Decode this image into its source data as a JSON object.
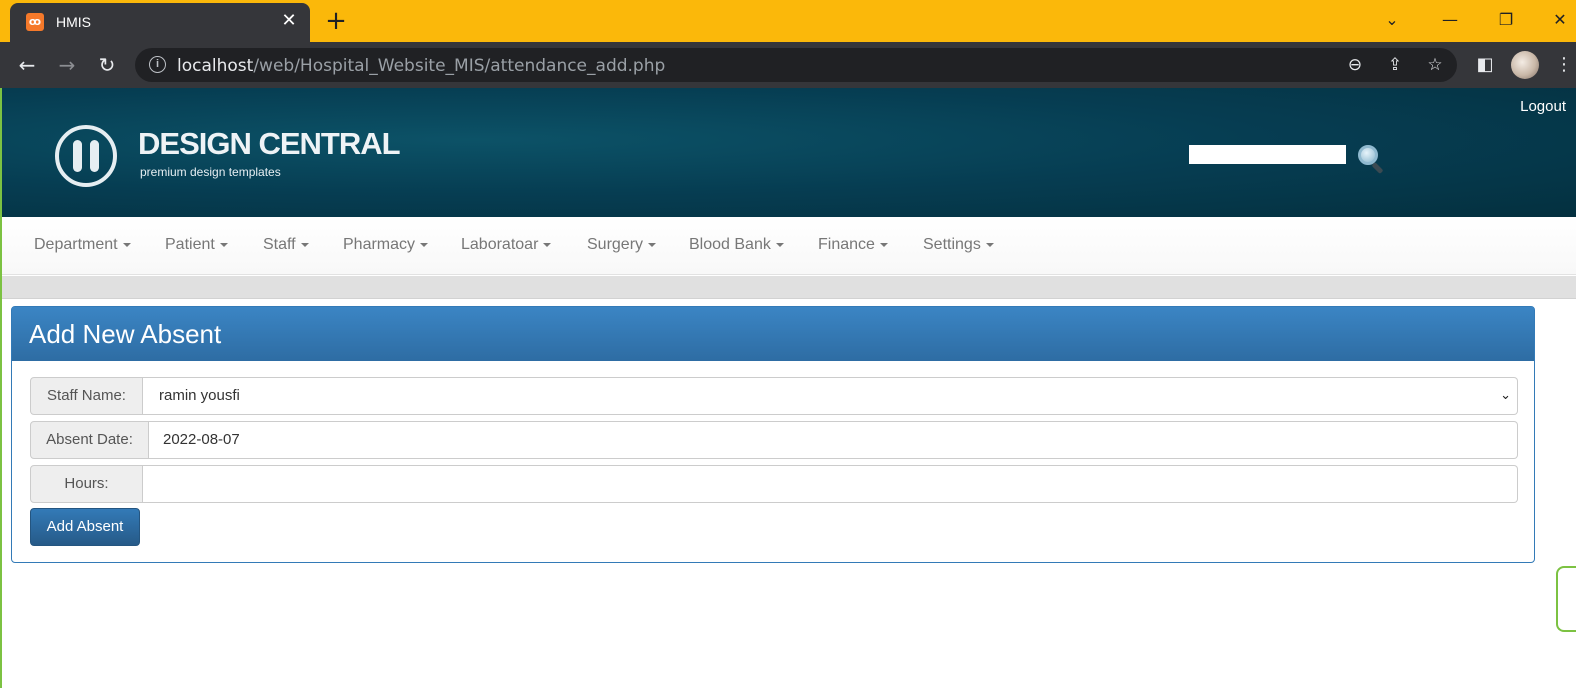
{
  "browser": {
    "tab_title": "HMIS",
    "tab_favicon": "xampp-icon",
    "url_host": "localhost",
    "url_path": "/web/Hospital_Website_MIS/attendance_add.php"
  },
  "header": {
    "logo_title": "DESIGN CENTRAL",
    "logo_subtitle": "premium design templates",
    "logout_label": "Logout",
    "search_value": ""
  },
  "nav": {
    "items": [
      {
        "label": "Department"
      },
      {
        "label": "Patient"
      },
      {
        "label": "Staff"
      },
      {
        "label": "Pharmacy"
      },
      {
        "label": "Laboratoar"
      },
      {
        "label": "Surgery"
      },
      {
        "label": "Blood Bank"
      },
      {
        "label": "Finance"
      },
      {
        "label": "Settings"
      }
    ]
  },
  "form": {
    "title": "Add New Absent",
    "staff_label": "Staff Name:",
    "staff_value": "ramin yousfi",
    "date_label": "Absent Date:",
    "date_value": "2022-08-07",
    "hours_label": "Hours:",
    "hours_value": "",
    "submit_label": "Add Absent"
  },
  "colors": {
    "tabbar": "#FBB80A",
    "chrome_dark": "#35363A",
    "header_bg": "#063d52",
    "panel_primary": "#337ab7"
  }
}
